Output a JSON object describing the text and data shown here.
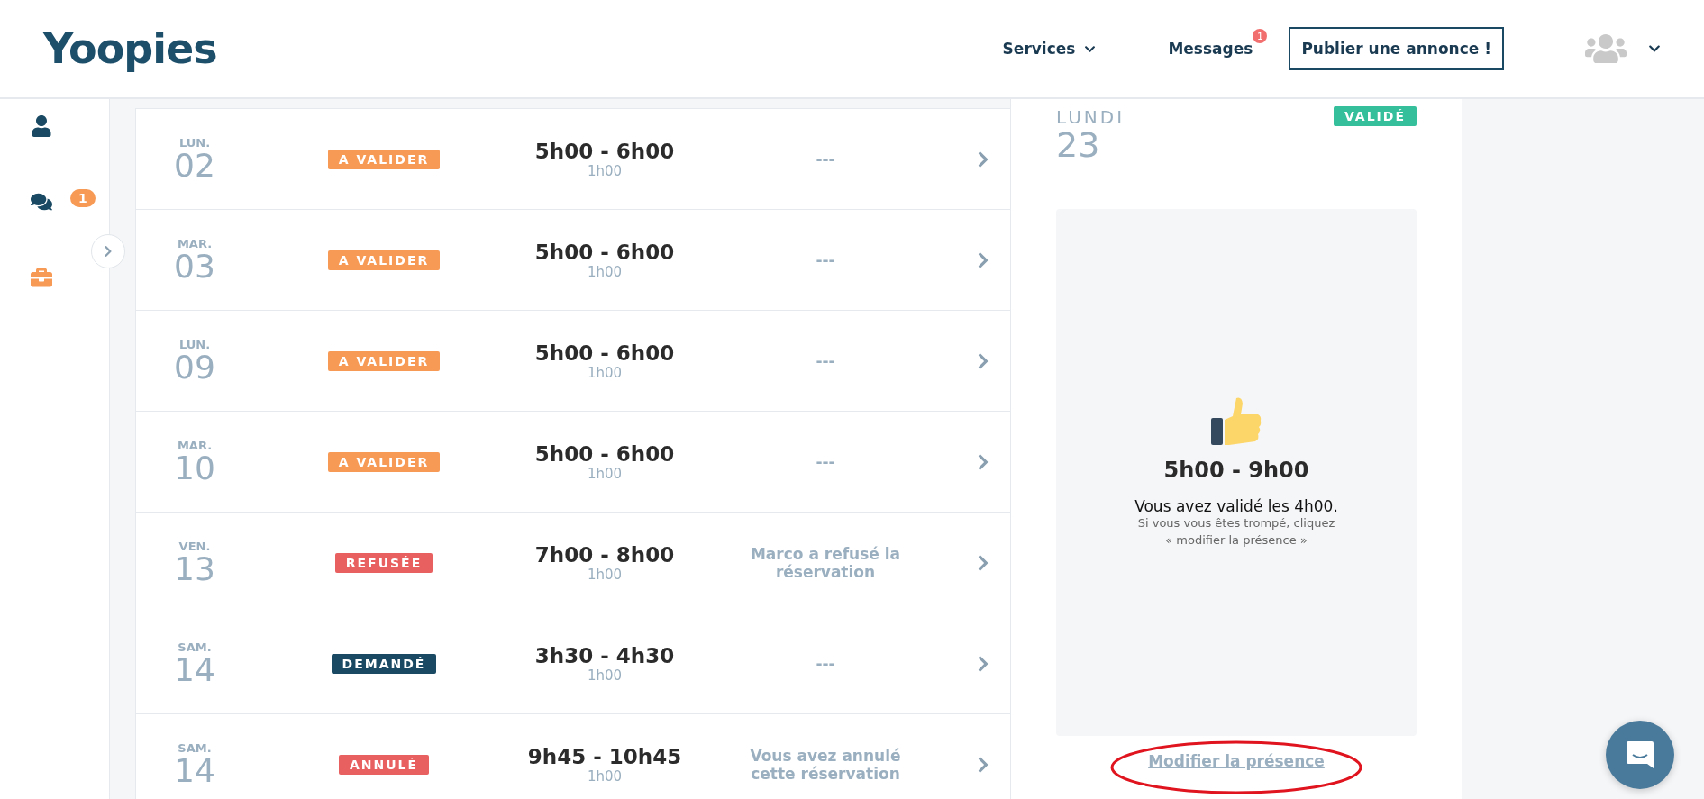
{
  "header": {
    "logo": "Yoopies",
    "nav": [
      {
        "label": "Services",
        "kind": "dropdown"
      },
      {
        "label": "Messages",
        "kind": "badge",
        "badge": "1"
      }
    ],
    "cta": "Publier une annonce !"
  },
  "sidebar": {
    "items": [
      {
        "kind": "profile"
      },
      {
        "kind": "messages",
        "badge": "1"
      },
      {
        "kind": "jobs"
      }
    ]
  },
  "bookings": [
    {
      "weekday": "LUN.",
      "day": "02",
      "status": {
        "label": "A VALIDER",
        "kind": "pending"
      },
      "time": "5h00 - 6h00",
      "duration": "1h00",
      "note": "---"
    },
    {
      "weekday": "MAR.",
      "day": "03",
      "status": {
        "label": "A VALIDER",
        "kind": "pending"
      },
      "time": "5h00 - 6h00",
      "duration": "1h00",
      "note": "---"
    },
    {
      "weekday": "LUN.",
      "day": "09",
      "status": {
        "label": "A VALIDER",
        "kind": "pending"
      },
      "time": "5h00 - 6h00",
      "duration": "1h00",
      "note": "---"
    },
    {
      "weekday": "MAR.",
      "day": "10",
      "status": {
        "label": "A VALIDER",
        "kind": "pending"
      },
      "time": "5h00 - 6h00",
      "duration": "1h00",
      "note": "---"
    },
    {
      "weekday": "VEN.",
      "day": "13",
      "status": {
        "label": "REFUSÉE",
        "kind": "refused"
      },
      "time": "7h00 - 8h00",
      "duration": "1h00",
      "note": "Marco a refusé la réservation"
    },
    {
      "weekday": "SAM.",
      "day": "14",
      "status": {
        "label": "DEMANDÉ",
        "kind": "requested"
      },
      "time": "3h30 - 4h30",
      "duration": "1h00",
      "note": "---"
    },
    {
      "weekday": "SAM.",
      "day": "14",
      "status": {
        "label": "ANNULÉ",
        "kind": "cancelled"
      },
      "time": "9h45 - 10h45",
      "duration": "1h00",
      "note": "Vous avez annulé cette réservation"
    }
  ],
  "detail": {
    "weekday": "LUNDI",
    "day": "23",
    "status": {
      "label": "VALIDÉ",
      "kind": "validated"
    },
    "time": "5h00 - 9h00",
    "message": "Vous avez validé les 4h00.",
    "hint": "Si vous vous êtes trompé, cliquez\n« modifier la présence »",
    "link": "Modifier la présence"
  }
}
